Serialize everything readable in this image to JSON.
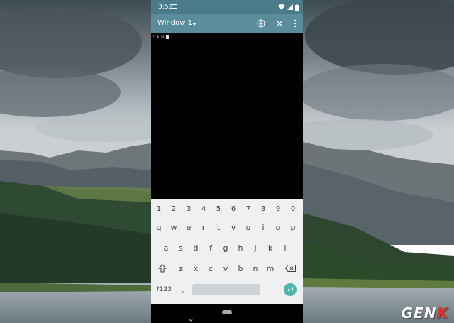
{
  "status_bar": {
    "time": "3:52"
  },
  "toolbar": {
    "window_title": "Window 1"
  },
  "terminal": {
    "prompt": "/ $ su"
  },
  "keyboard": {
    "number_row": [
      "1",
      "2",
      "3",
      "4",
      "5",
      "6",
      "7",
      "8",
      "9",
      "0"
    ],
    "row1": [
      "q",
      "w",
      "e",
      "r",
      "t",
      "y",
      "u",
      "i",
      "o",
      "p"
    ],
    "row2": [
      "a",
      "s",
      "d",
      "f",
      "g",
      "h",
      "j",
      "k",
      "l"
    ],
    "row3": [
      "z",
      "x",
      "c",
      "v",
      "b",
      "n",
      "m"
    ],
    "symbols_label": "?123",
    "comma": ",",
    "period": "."
  },
  "watermark": {
    "text_main": "GEN",
    "text_accent": "K"
  },
  "colors": {
    "status_bar": "#4b7a8a",
    "toolbar": "#5b8c9b",
    "terminal_bg": "#000000",
    "keyboard_bg": "#eef0f1",
    "enter_accent": "#4db6ac"
  }
}
